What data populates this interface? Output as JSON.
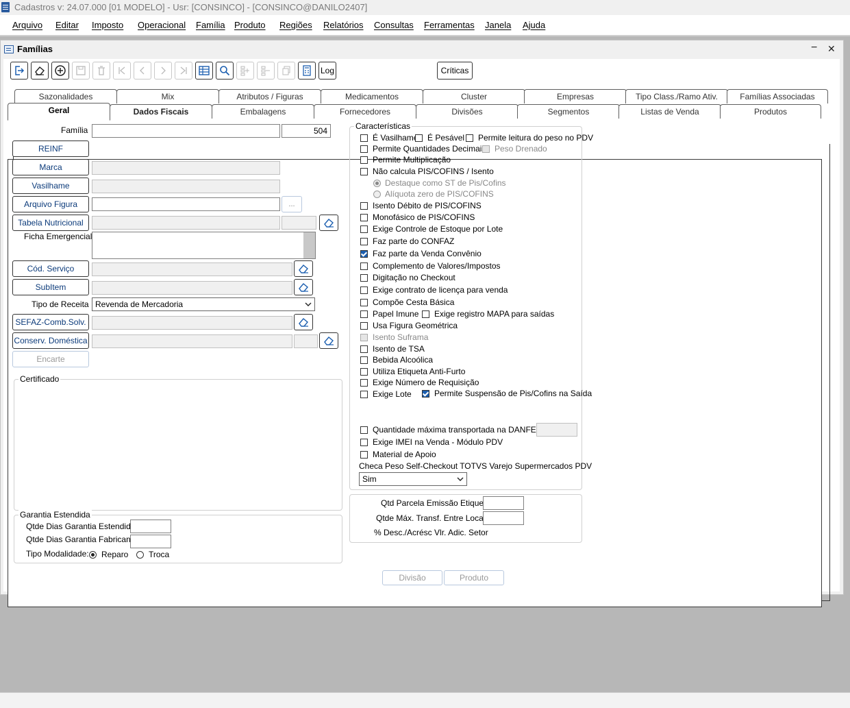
{
  "titlebar": {
    "title": "Cadastros  v: 24.07.000   [01 MODELO] - Usr: [CONSINCO] - [CONSINCO@DANILO2407]"
  },
  "menubar": {
    "items": [
      "Arquivo",
      "Editar",
      "Imposto",
      "Operacional",
      "Família",
      "Produto",
      "Regiões",
      "Relatórios",
      "Consultas",
      "Ferramentas",
      "Janela",
      "Ajuda"
    ]
  },
  "window": {
    "title": "Famílias",
    "minimize": "−",
    "close": "✕"
  },
  "toolbar": {
    "log_label": "Log",
    "criticas_label": "Críticas"
  },
  "tabs": {
    "back_row": [
      "Sazonalidades",
      "Mix",
      "Atributos / Figuras",
      "Medicamentos",
      "Cluster",
      "Empresas",
      "Tipo Class./Ramo Ativ.",
      "Famílias Associadas"
    ],
    "front_row": [
      "Geral",
      "Dados Fiscais",
      "Embalagens",
      "Fornecedores",
      "Divisões",
      "Segmentos",
      "Listas de Venda",
      "Produtos"
    ],
    "active": "Geral"
  },
  "form": {
    "familia_label": "Família",
    "familia_value": "",
    "familia_code": "504",
    "reinf": "REINF",
    "marca": "Marca",
    "vasilhame": "Vasilhame",
    "arquivo_figura": "Arquivo Figura",
    "browse": "...",
    "tabela_nutricional": "Tabela Nutricional",
    "ficha_emergencial": "Ficha Emergencial",
    "cod_servico": "Cód. Serviço",
    "subitem": "SubItem",
    "tipo_receita_label": "Tipo de Receita",
    "tipo_receita_value": "Revenda de Mercadoria",
    "sefaz": "SEFAZ-Comb.Solv.",
    "conserv": "Conserv. Doméstica",
    "encarte": "Encarte",
    "certificado": "Certificado"
  },
  "garantia": {
    "title": "Garantia Estendida",
    "dias_estendida": "Qtde Dias Garantia Estendida",
    "dias_fabricante": "Qtde Dias Garantia Fabricante",
    "modalidade": "Tipo Modalidade:",
    "reparo": "Reparo",
    "troca": "Troca"
  },
  "caracteristicas": {
    "title": "Características",
    "vasilhame": "É Vasilhame",
    "pesavel": "É Pesável",
    "leitura_peso": "Permite leitura do peso no PDV",
    "qtd_decimais": "Permite Quantidades Decimais",
    "peso_drenado": "Peso Drenado",
    "multiplicacao": "Permite Multiplicação",
    "nao_calcula": "Não calcula PIS/COFINS / Isento",
    "destaque_st": "Destaque como ST de Pis/Cofins",
    "aliquota_zero": "Alíquota zero de PIS/COFINS",
    "isento_debito": "Isento Débito de PIS/COFINS",
    "monofasico": "Monofásico de PIS/COFINS",
    "controle_lote": "Exige Controle de Estoque por Lote",
    "confaz": "Faz parte do CONFAZ",
    "venda_convenio": "Faz parte da Venda Convênio",
    "complemento": "Complemento de Valores/Impostos",
    "digitacao": "Digitação no Checkout",
    "contrato_licenca": "Exige contrato de licença para venda",
    "cesta_basica": "Compõe Cesta Básica",
    "papel_imune": "Papel Imune",
    "registro_mapa": "Exige registro MAPA para saídas",
    "figura_geometrica": "Usa Figura Geométrica",
    "isento_suframa": "Isento Suframa",
    "isento_tsa": "Isento de TSA",
    "bebida_alcoolica": "Bebida Alcoólica",
    "anti_furto": "Utiliza Etiqueta Anti-Furto",
    "requisicao": "Exige Número de Requisição",
    "exige_lote": "Exige Lote",
    "suspensao_pis": "Permite Suspensão de Pis/Cofins na Saída",
    "qtd_danfe": "Quantidade máxima transportada na DANFE (KG)",
    "imei": "Exige IMEI na Venda - Módulo PDV",
    "material_apoio": "Material de Apoio",
    "checa_peso": "Checa Peso Self-Checkout TOTVS Varejo Supermercados PDV",
    "checa_peso_value": "Sim"
  },
  "etiqueta": {
    "parcela": "Qtd Parcela Emissão Etiqueta",
    "transf": "Qtde Máx. Transf. Entre Locais",
    "desc": "% Desc./Acrésc Vlr. Adic. Setor"
  },
  "bottom": {
    "divisao": "Divisão",
    "produto": "Produto"
  },
  "colors": {
    "accent": "#1c5fb0",
    "link_text": "#0b3a7a",
    "workspace": "#b7b7b7"
  }
}
